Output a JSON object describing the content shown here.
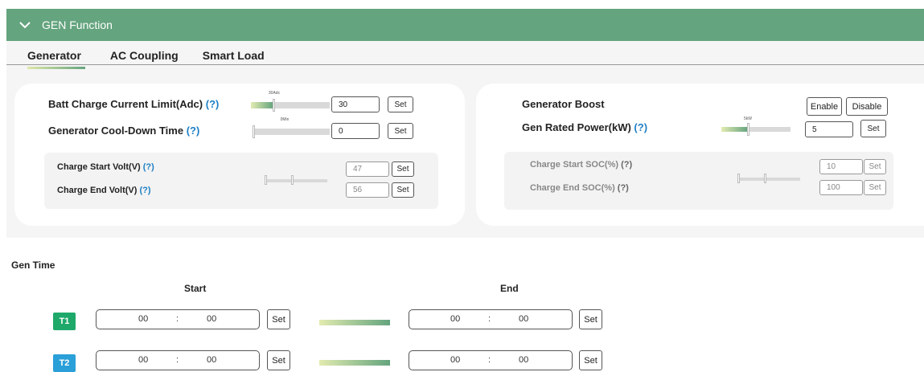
{
  "header": {
    "title": "GEN Function",
    "icon": "chevron-down-icon"
  },
  "tabs": [
    {
      "label": "Generator",
      "active": true
    },
    {
      "label": "AC Coupling",
      "active": false
    },
    {
      "label": "Smart Load",
      "active": false
    }
  ],
  "left_card": {
    "batt_charge": {
      "label": "Batt Charge Current Limit(Adc)",
      "help": "(?)",
      "slider_tip": "30Adc",
      "value": "30",
      "set": "Set"
    },
    "cooldown": {
      "label": "Generator Cool-Down Time",
      "help": "(?)",
      "slider_tip": "0Min",
      "value": "0",
      "set": "Set"
    },
    "charge_start": {
      "label": "Charge Start Volt(V)",
      "help": "(?)",
      "value": "47",
      "set": "Set"
    },
    "charge_end": {
      "label": "Charge End Volt(V)",
      "help": "(?)",
      "value": "56",
      "set": "Set"
    }
  },
  "right_card": {
    "boost": {
      "label": "Generator Boost",
      "enable": "Enable",
      "disable": "Disable"
    },
    "rated_power": {
      "label": "Gen Rated Power(kW)",
      "help": "(?)",
      "slider_tip": "5kW",
      "value": "5",
      "set": "Set"
    },
    "soc_start": {
      "label": "Charge Start SOC(%)",
      "help": "(?)",
      "value": "10",
      "set": "Set"
    },
    "soc_end": {
      "label": "Charge End SOC(%)",
      "help": "(?)",
      "value": "100",
      "set": "Set"
    }
  },
  "gen_time": {
    "title": "Gen Time",
    "start_header": "Start",
    "end_header": "End",
    "colon": ":",
    "set": "Set",
    "rows": [
      {
        "label": "T1",
        "color": "#1ea86a",
        "start_h": "00",
        "start_m": "00",
        "end_h": "00",
        "end_m": "00"
      },
      {
        "label": "T2",
        "color": "#2a9fd8",
        "start_h": "00",
        "start_m": "00",
        "end_h": "00",
        "end_m": "00"
      }
    ]
  },
  "colors": {
    "header": "#64a47e",
    "help": "#1e7fc5"
  }
}
